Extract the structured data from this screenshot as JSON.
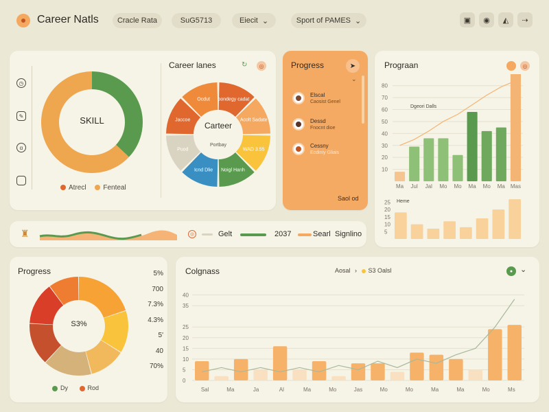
{
  "header": {
    "title": "Career Natls",
    "pills": [
      "Cracle Rata",
      "SuG5713",
      "Eiecit",
      "Sport of PAMES"
    ],
    "top_icons": [
      "briefcase-icon",
      "badge-icon",
      "chart-icon",
      "share-icon"
    ]
  },
  "left_rail": {
    "icons": [
      "clock-icon",
      "edit-icon",
      "apple-icon",
      "folder-icon"
    ]
  },
  "skill_card": {
    "center_label": "SKILL",
    "legend": [
      "Atrecl",
      "Fenteal"
    ],
    "chart_data": {
      "type": "pie",
      "labels": [
        "Atrecl",
        "Fenteal"
      ],
      "values": [
        37,
        63
      ],
      "colors": [
        "#5a9a4e",
        "#eea64f"
      ]
    }
  },
  "career_lanes": {
    "title": "Career lanes",
    "center_title": "Carteer",
    "center_sub": "Portbay",
    "segments": [
      "Ibondegy cadat",
      "Acolt Sadate",
      "WAD 3.55",
      "Noigl Hanh",
      "Icnd Dlie",
      "Puod",
      "Jaccoe",
      "Ocdut"
    ]
  },
  "progress_card": {
    "title": "Progress",
    "items": [
      {
        "name": "Elscal",
        "sub": "Caosist Genel"
      },
      {
        "name": "Dessd",
        "sub": "Fnocnt dioe"
      },
      {
        "name": "Cessny",
        "sub": "Ecdiniy Gliais"
      }
    ],
    "footer": "Saol od"
  },
  "program_card": {
    "title": "Prograan",
    "line_label": "Dgeori Dalls",
    "lower_label": "Heme",
    "chart_data": {
      "type": "bar",
      "categories": [
        "Ma",
        "Jul",
        "Jal",
        "Mo",
        "Mo",
        "Ma",
        "Mo",
        "Ma",
        "Mas"
      ],
      "ylim": [
        0,
        85
      ],
      "yticks": [
        10,
        20,
        30,
        40,
        50,
        60,
        70,
        80
      ],
      "values": [
        8,
        29,
        36,
        36,
        22,
        58,
        42,
        45,
        90
      ],
      "line_values": [
        30,
        35,
        42,
        50,
        56,
        64,
        72,
        79,
        84
      ]
    },
    "lower_chart_data": {
      "type": "bar",
      "yticks": [
        5,
        10,
        15,
        20,
        25
      ],
      "values": [
        18,
        10,
        7,
        12,
        8,
        14,
        20,
        27
      ]
    }
  },
  "timeline": {
    "label": "Gelt",
    "year": "2037",
    "right_label": "Searl",
    "right_sub": "Signlino"
  },
  "progress_bottom": {
    "title": "Progress",
    "center_label": "S3%",
    "right_labels": [
      "5%",
      "700",
      "7.3%",
      "4.3%",
      "5'",
      "40",
      "70%"
    ],
    "legend": [
      "Dy",
      "Rod"
    ],
    "chart_data": {
      "type": "pie",
      "values": [
        20,
        14,
        12,
        16,
        14,
        14,
        10
      ],
      "colors": [
        "#f6a235",
        "#f9c43c",
        "#f2b95c",
        "#d4b27a",
        "#c5502e",
        "#d93f28",
        "#ee7d32"
      ]
    }
  },
  "colgness": {
    "title": "Colgnass",
    "legend_a": "Aosal",
    "legend_b": "S3 Oalsl",
    "chart_data": {
      "type": "bar",
      "categories": [
        "Sal",
        "Ma",
        "Ja",
        "Al",
        "Ma",
        "Mo",
        "Jas",
        "Mo",
        "Mo",
        "Ma",
        "Ma",
        "Mo",
        "Ms"
      ],
      "ylim": [
        0,
        45
      ],
      "yticks": [
        0,
        5,
        10,
        15,
        20,
        25,
        35,
        40
      ],
      "values": [
        9,
        2,
        10,
        5,
        16,
        5,
        9,
        2,
        8,
        8,
        4,
        13,
        12,
        10,
        5,
        24,
        26
      ],
      "line_values": [
        4,
        6,
        4,
        6,
        4,
        6,
        4,
        7,
        5,
        9,
        6,
        10,
        8,
        12,
        15,
        25,
        38
      ]
    }
  },
  "colors": {
    "orange": "#f4a860",
    "green": "#5a9a4e",
    "bg": "#ece8d6",
    "card": "#f6f3e7"
  }
}
